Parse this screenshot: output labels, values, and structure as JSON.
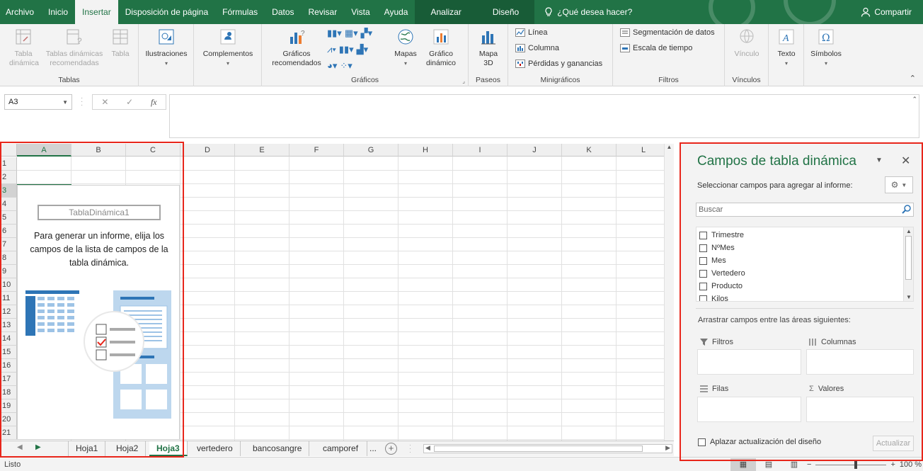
{
  "menu": {
    "tabs": [
      "Archivo",
      "Inicio",
      "Insertar",
      "Disposición de página",
      "Fórmulas",
      "Datos",
      "Revisar",
      "Vista",
      "Ayuda"
    ],
    "active_tab": "Insertar",
    "context_tabs": [
      "Analizar",
      "Diseño"
    ],
    "tell_me": "¿Qué desea hacer?",
    "share": "Compartir"
  },
  "ribbon": {
    "tablas": {
      "label": "Tablas",
      "tabla_dinamica": "Tabla dinámica",
      "tablas_recomendadas": "Tablas dinámicas recomendadas",
      "tabla": "Tabla"
    },
    "ilustraciones": "Ilustraciones",
    "complementos": "Complementos",
    "graficos": {
      "label": "Gráficos",
      "recomendados": "Gráficos recomendados",
      "mapas": "Mapas",
      "grafico_dinamico": "Gráfico dinámico"
    },
    "paseos": {
      "label": "Paseos",
      "mapa3d": "Mapa 3D"
    },
    "minigraficos": {
      "label": "Minigráficos",
      "linea": "Línea",
      "columna": "Columna",
      "perdidas": "Pérdidas y ganancias"
    },
    "filtros": {
      "label": "Filtros",
      "segmentacion": "Segmentación de datos",
      "escala": "Escala de tiempo"
    },
    "vinculos": {
      "label": "Vínculos",
      "vinculo": "Vínculo"
    },
    "texto": "Texto",
    "simbolos": "Símbolos"
  },
  "formula_bar": {
    "name_box": "A3",
    "fx": "fx",
    "value": ""
  },
  "grid": {
    "columns": [
      "A",
      "B",
      "C",
      "D",
      "E",
      "F",
      "G",
      "H",
      "I",
      "J",
      "K",
      "L"
    ],
    "rows": [
      "1",
      "2",
      "3",
      "4",
      "5",
      "6",
      "7",
      "8",
      "9",
      "10",
      "11",
      "12",
      "13",
      "14",
      "15",
      "16",
      "17",
      "18",
      "19",
      "20",
      "21"
    ],
    "selected_column": "A",
    "selected_row": "3"
  },
  "pivot_placeholder": {
    "name": "TablaDinámica1",
    "message": "Para generar un informe, elija los campos de la lista de campos de la tabla dinámica."
  },
  "sheets": {
    "tabs": [
      "Hoja1",
      "Hoja2",
      "Hoja3",
      "vertedero",
      "bancosangre",
      "camporef"
    ],
    "active": "Hoja3",
    "more": "..."
  },
  "status": {
    "ready": "Listo",
    "zoom": "100 %"
  },
  "field_pane": {
    "title": "Campos de tabla dinámica",
    "subtitle": "Seleccionar campos para agregar al informe:",
    "search_placeholder": "Buscar",
    "fields": [
      "Trimestre",
      "NºMes",
      "Mes",
      "Vertedero",
      "Producto",
      "Kilos"
    ],
    "drag_text": "Arrastrar campos entre las áreas siguientes:",
    "areas": {
      "filtros": "Filtros",
      "columnas": "Columnas",
      "filas": "Filas",
      "valores": "Valores"
    },
    "defer_label": "Aplazar actualización del diseño",
    "update_button": "Actualizar"
  },
  "colors": {
    "accent": "#217346",
    "highlight": "#e8261b"
  }
}
